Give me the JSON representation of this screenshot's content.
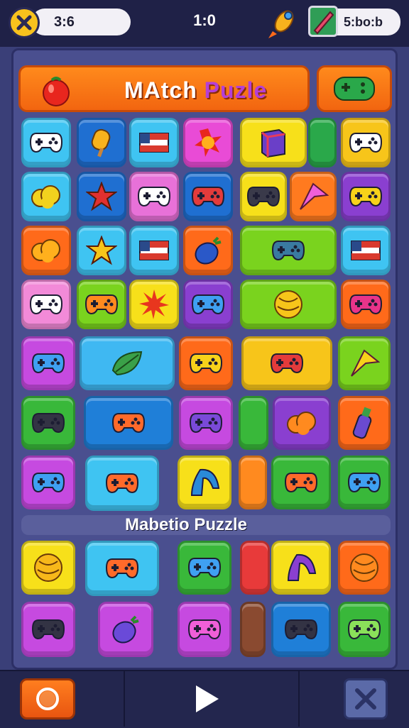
{
  "header": {
    "timer": "3:6",
    "center_value": "1:0",
    "coins": "5:bo:b"
  },
  "title_banner": {
    "title_part1": "MAtch ",
    "title_part2": "Puzle"
  },
  "sub_banner": {
    "text": "Mabetio Puzzle"
  },
  "colors": {
    "background": "#3a3f78",
    "board": "#4a4f8f",
    "banner": "#f26510",
    "title_accent": "#b43fd6"
  },
  "tiles": [
    {
      "name": "tile-controller-white",
      "color": "#3fc4f2",
      "icon": "controller",
      "icon_color": "#ffffff"
    },
    {
      "name": "tile-popsicle",
      "color": "#1f6fd1",
      "icon": "popsicle",
      "icon_color": "#f8b21d"
    },
    {
      "name": "tile-flag-1",
      "color": "#3fc4f2",
      "icon": "flag",
      "icon_color": "#d93a2e"
    },
    {
      "name": "tile-star-flower",
      "color": "#e94bd6",
      "icon": "flower",
      "icon_color": "#ff7a1f"
    },
    {
      "name": "tile-cube",
      "color": "#f7e01a",
      "icon": "cube",
      "icon_color": "#6a3fc8"
    },
    {
      "name": "tile-green-strip",
      "color": "#2aa84a",
      "icon": "none",
      "icon_color": ""
    },
    {
      "name": "tile-controller-white-2",
      "color": "#f7c51a",
      "icon": "controller",
      "icon_color": "#ffffff"
    },
    {
      "name": "tile-cookie",
      "color": "#3fc4f2",
      "icon": "blob",
      "icon_color": "#f2d21e"
    },
    {
      "name": "tile-red-star",
      "color": "#1f6fd1",
      "icon": "star",
      "icon_color": "#e03030"
    },
    {
      "name": "tile-controller-pink",
      "color": "#e871d8",
      "icon": "controller",
      "icon_color": "#ffffff"
    },
    {
      "name": "tile-controller-red",
      "color": "#1f6fd1",
      "icon": "controller",
      "icon_color": "#e33b3b"
    },
    {
      "name": "tile-controller-dark",
      "color": "#f7e01a",
      "icon": "controller",
      "icon_color": "#3a3a4a"
    },
    {
      "name": "tile-arrow-pink",
      "color": "#ff7a1f",
      "icon": "arrow",
      "icon_color": "#f05fd8"
    },
    {
      "name": "tile-controller-yellow",
      "color": "#8a3fd0",
      "icon": "controller",
      "icon_color": "#f7d21a"
    },
    {
      "name": "tile-orange-blob",
      "color": "#ff6a1a",
      "icon": "blob",
      "icon_color": "#ffb01d"
    },
    {
      "name": "tile-yellow-star",
      "color": "#3fc4f2",
      "icon": "star",
      "icon_color": "#f7c51a"
    },
    {
      "name": "tile-flag-2",
      "color": "#3fc4f2",
      "icon": "flag",
      "icon_color": "#d93a2e"
    },
    {
      "name": "tile-blueberry",
      "color": "#ff6a1a",
      "icon": "berry",
      "icon_color": "#2a58c8"
    },
    {
      "name": "tile-controller-teal-wide",
      "color": "#7ad31e",
      "icon": "controller",
      "icon_color": "#3a7aa0"
    },
    {
      "name": "tile-flag-3",
      "color": "#3fc4f2",
      "icon": "flag",
      "icon_color": "#d93a2e"
    },
    {
      "name": "tile-controller-white-3",
      "color": "#f28ad8",
      "icon": "controller",
      "icon_color": "#ffffff"
    },
    {
      "name": "tile-controller-orange",
      "color": "#7ad31e",
      "icon": "controller",
      "icon_color": "#ff8a1f"
    },
    {
      "name": "tile-burst",
      "color": "#f7e01a",
      "icon": "burst",
      "icon_color": "#e8361e"
    },
    {
      "name": "tile-controller-blue",
      "color": "#8a3fd0",
      "icon": "controller",
      "icon_color": "#3fa0f2"
    },
    {
      "name": "tile-shell",
      "color": "#7ad31e",
      "icon": "ball",
      "icon_color": "#f7c51a"
    },
    {
      "name": "tile-controller-magenta",
      "color": "#ff6a1a",
      "icon": "controller",
      "icon_color": "#e8348a"
    },
    {
      "name": "tile-controller-blue-2",
      "color": "#c64ae0",
      "icon": "controller",
      "icon_color": "#3fa0f2"
    },
    {
      "name": "tile-leaf",
      "color": "#3fb8f2",
      "icon": "leaf",
      "icon_color": "#3aa048"
    },
    {
      "name": "tile-controller-yellow-2",
      "color": "#ff6a1a",
      "icon": "controller",
      "icon_color": "#f7d21a"
    },
    {
      "name": "tile-controller-red-2",
      "color": "#f7c51a",
      "icon": "controller",
      "icon_color": "#e33b3b"
    },
    {
      "name": "tile-arrow-yellow",
      "color": "#7ad31e",
      "icon": "arrow",
      "icon_color": "#f7d21a"
    },
    {
      "name": "tile-controller-dark-2",
      "color": "#39b83a",
      "icon": "controller",
      "icon_color": "#333344"
    },
    {
      "name": "tile-controller-orange-2",
      "color": "#1f7fd8",
      "icon": "controller",
      "icon_color": "#ff6a2a"
    },
    {
      "name": "tile-controller-purple",
      "color": "#c64ae0",
      "icon": "controller",
      "icon_color": "#7a4ad8"
    },
    {
      "name": "tile-green-strip-2",
      "color": "#39b83a",
      "icon": "none",
      "icon_color": ""
    },
    {
      "name": "tile-mushroom",
      "color": "#8a3fd0",
      "icon": "blob",
      "icon_color": "#ff8a1f"
    },
    {
      "name": "tile-bottle",
      "color": "#ff6a1a",
      "icon": "bottle",
      "icon_color": "#6a4ad0"
    },
    {
      "name": "tile-controller-blue-3",
      "color": "#c64ae0",
      "icon": "controller",
      "icon_color": "#3fa0f2"
    },
    {
      "name": "tile-controller-orange-3",
      "color": "#3fc4f2",
      "icon": "controller",
      "icon_color": "#ff6a2a"
    },
    {
      "name": "tile-boot",
      "color": "#f7e01a",
      "icon": "boot",
      "icon_color": "#2a8ad8"
    },
    {
      "name": "tile-orange-strip",
      "color": "#ff8a1f",
      "icon": "none",
      "icon_color": ""
    },
    {
      "name": "tile-controller-orange-4",
      "color": "#39b83a",
      "icon": "controller",
      "icon_color": "#ff6a2a"
    },
    {
      "name": "tile-controller-blue-4",
      "color": "#39b83a",
      "icon": "controller",
      "icon_color": "#3fa0f2"
    },
    {
      "name": "tile-ball-yellow",
      "color": "#f7e01a",
      "icon": "ball",
      "icon_color": "#f7b81a"
    },
    {
      "name": "tile-controller-orange-5",
      "color": "#3fc4f2",
      "icon": "controller",
      "icon_color": "#ff6a2a"
    },
    {
      "name": "tile-controller-blue-5",
      "color": "#39b83a",
      "icon": "controller",
      "icon_color": "#3fa0f2"
    },
    {
      "name": "tile-red-strip",
      "color": "#e83a3a",
      "icon": "none",
      "icon_color": ""
    },
    {
      "name": "tile-boot-2",
      "color": "#f7e01a",
      "icon": "boot",
      "icon_color": "#8a3fd0"
    },
    {
      "name": "tile-orange-ball",
      "color": "#ff6a1a",
      "icon": "ball",
      "icon_color": "#ff8a1f"
    },
    {
      "name": "tile-controller-dark-3",
      "color": "#c64ae0",
      "icon": "controller",
      "icon_color": "#333344"
    },
    {
      "name": "tile-eggplant",
      "color": "#c64ae0",
      "icon": "berry",
      "icon_color": "#6a4ad8"
    },
    {
      "name": "tile-controller-pink-2",
      "color": "#c64ae0",
      "icon": "controller",
      "icon_color": "#f05fd8"
    },
    {
      "name": "tile-brown-strip",
      "color": "#8a4a30",
      "icon": "none",
      "icon_color": ""
    },
    {
      "name": "tile-controller-dark-4",
      "color": "#1f7fd8",
      "icon": "controller",
      "icon_color": "#333344"
    },
    {
      "name": "tile-controller-green",
      "color": "#39b83a",
      "icon": "controller",
      "icon_color": "#8ae05a"
    }
  ]
}
